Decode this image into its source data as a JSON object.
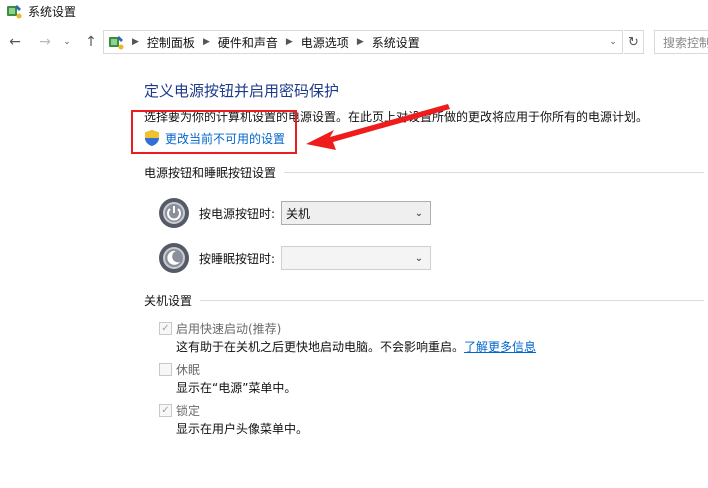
{
  "window": {
    "title": "系统设置",
    "icon": "control-panel-power-icon"
  },
  "nav": {
    "back_icon": "back-arrow-icon",
    "forward_icon": "forward-arrow-icon",
    "recent_icon": "chevron-down-icon",
    "up_icon": "up-arrow-icon",
    "breadcrumbs": [
      "控制面板",
      "硬件和声音",
      "电源选项",
      "系统设置"
    ],
    "refresh_icon": "refresh-icon",
    "search_placeholder": "搜索控制面板"
  },
  "main": {
    "title": "定义电源按钮并启用密码保护",
    "description": "选择要为你的计算机设置的电源设置。在此页上对设置所做的更改将应用于你所有的电源计划。",
    "change_link": "更改当前不可用的设置",
    "annotation_color": "#ee1c1c"
  },
  "buttons_section": {
    "heading": "电源按钮和睡眠按钮设置",
    "power_button": {
      "label": "按电源按钮时:",
      "value": "关机",
      "icon": "power-button-icon"
    },
    "sleep_button": {
      "label": "按睡眠按钮时:",
      "value": "",
      "icon": "sleep-button-icon"
    }
  },
  "shutdown_section": {
    "heading": "关机设置",
    "options": [
      {
        "label": "启用快速启动(推荐)",
        "checked": true,
        "description": "这有助于在关机之后更快地启动电脑。不会影响重启。",
        "link": "了解更多信息"
      },
      {
        "label": "休眠",
        "checked": false,
        "description": "显示在“电源”菜单中。"
      },
      {
        "label": "锁定",
        "checked": true,
        "description": "显示在用户头像菜单中。"
      }
    ]
  },
  "colors": {
    "title_blue": "#1e3a8a",
    "link_blue": "#0066cc",
    "highlight_red": "#ee1c1c"
  }
}
